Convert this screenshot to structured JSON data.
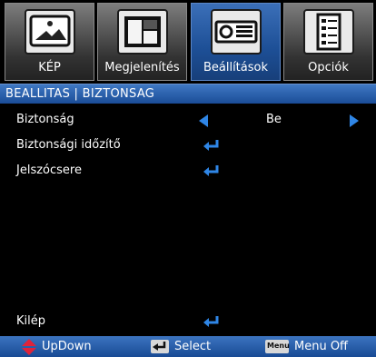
{
  "tabs": [
    {
      "label": "KÉP",
      "icon": "picture-icon"
    },
    {
      "label": "Megjelenítés",
      "icon": "display-icon"
    },
    {
      "label": "Beállítások",
      "icon": "projector-icon"
    },
    {
      "label": "Opciók",
      "icon": "options-icon"
    }
  ],
  "header": {
    "title": "BEALLITAS | BIZTONSAG"
  },
  "items": [
    {
      "label": "Biztonság",
      "value": "Be"
    },
    {
      "label": "Biztonsági időzítő"
    },
    {
      "label": "Jelszócsere"
    }
  ],
  "exit": {
    "label": "Kilép"
  },
  "footer": {
    "updown": "UpDown",
    "select": "Select",
    "menu_key": "Menu",
    "menu_off": "Menu Off"
  },
  "colors": {
    "accent": "#1d4f96",
    "arrow": "#2f86e6",
    "updown": "#e0233a"
  }
}
